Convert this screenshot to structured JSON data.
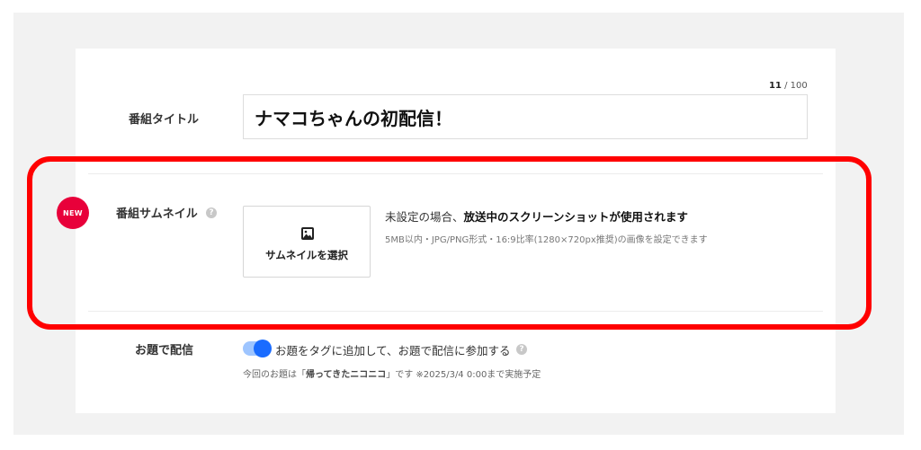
{
  "program_title": {
    "label": "番組タイトル",
    "value": "ナマコちゃんの初配信！",
    "count_current": "11",
    "count_separator": " / ",
    "count_max": "100"
  },
  "thumbnail": {
    "badge": "NEW",
    "label": "番組サムネイル",
    "help_icon": "?",
    "button_label": "サムネイルを選択",
    "desc_prefix": "未設定の場合、",
    "desc_emphasis": "放送中のスクリーンショットが使用されます",
    "desc_sub": "5MB以内・JPG/PNG形式・16:9比率(1280×720px推奨)の画像を設定できます"
  },
  "theme": {
    "label": "お題で配信",
    "toggle_on": true,
    "toggle_label": "お題をタグに追加して、お題で配信に参加する",
    "help_icon": "?",
    "note_prefix": "今回のお題は「",
    "note_theme": "帰ってきたニコニコ",
    "note_suffix": "」です ※2025/3/4 0:00まで実施予定"
  },
  "colors": {
    "highlight": "#ff0000",
    "new_badge": "#e8003a",
    "toggle_knob": "#1a6cff",
    "toggle_track": "#9ec5ff"
  }
}
